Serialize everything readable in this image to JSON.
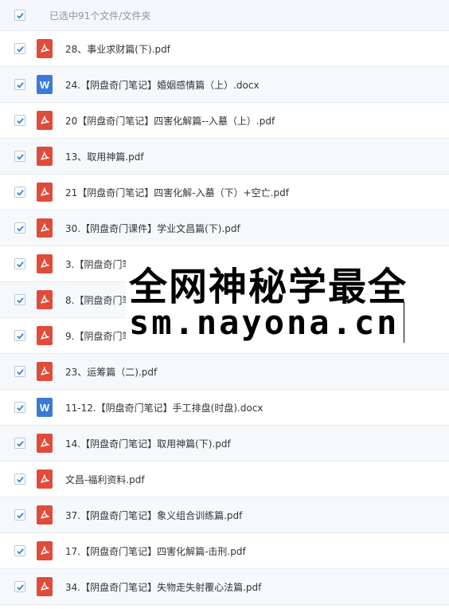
{
  "header": {
    "selected_text": "已选中91个文件/文件夹"
  },
  "files": [
    {
      "name": "28、事业求财篇(下).pdf",
      "type": "pdf"
    },
    {
      "name": "24.【阴盘奇门笔记】婚姻感情篇（上）.docx",
      "type": "doc"
    },
    {
      "name": "20【阴盘奇门笔记】四害化解篇--入墓（上）.pdf",
      "type": "pdf"
    },
    {
      "name": "13、取用神篇.pdf",
      "type": "pdf"
    },
    {
      "name": "21【阴盘奇门笔记】四害化解-入墓（下）+空亡.pdf",
      "type": "pdf"
    },
    {
      "name": "30.【阴盘奇门课件】学业文昌篇(下).pdf",
      "type": "pdf"
    },
    {
      "name": "3.【阴盘奇门笔",
      "type": "pdf"
    },
    {
      "name": "8.【阴盘奇门笔",
      "type": "pdf"
    },
    {
      "name": "9.【阴盘奇门笔",
      "type": "pdf"
    },
    {
      "name": "23、运筹篇（二).pdf",
      "type": "pdf"
    },
    {
      "name": "11-12.【阴盘奇门笔记】手工排盘(时盘).docx",
      "type": "doc"
    },
    {
      "name": "14.【阴盘奇门笔记】取用神篇(下).pdf",
      "type": "pdf"
    },
    {
      "name": "文昌-福利资料.pdf",
      "type": "pdf"
    },
    {
      "name": "37.【阴盘奇门笔记】象义组合训练篇.pdf",
      "type": "pdf"
    },
    {
      "name": "17.【阴盘奇门笔记】四害化解篇-击刑.pdf",
      "type": "pdf"
    },
    {
      "name": "34.【阴盘奇门笔记】失物走失射覆心法篇.pdf",
      "type": "pdf"
    }
  ],
  "watermark": {
    "line1": "全网神秘学最全",
    "line2": "sm.nayona.cn"
  },
  "colors": {
    "check": "#2f8ad8",
    "pdf": "#e04b3a",
    "doc": "#3d7ad8"
  }
}
